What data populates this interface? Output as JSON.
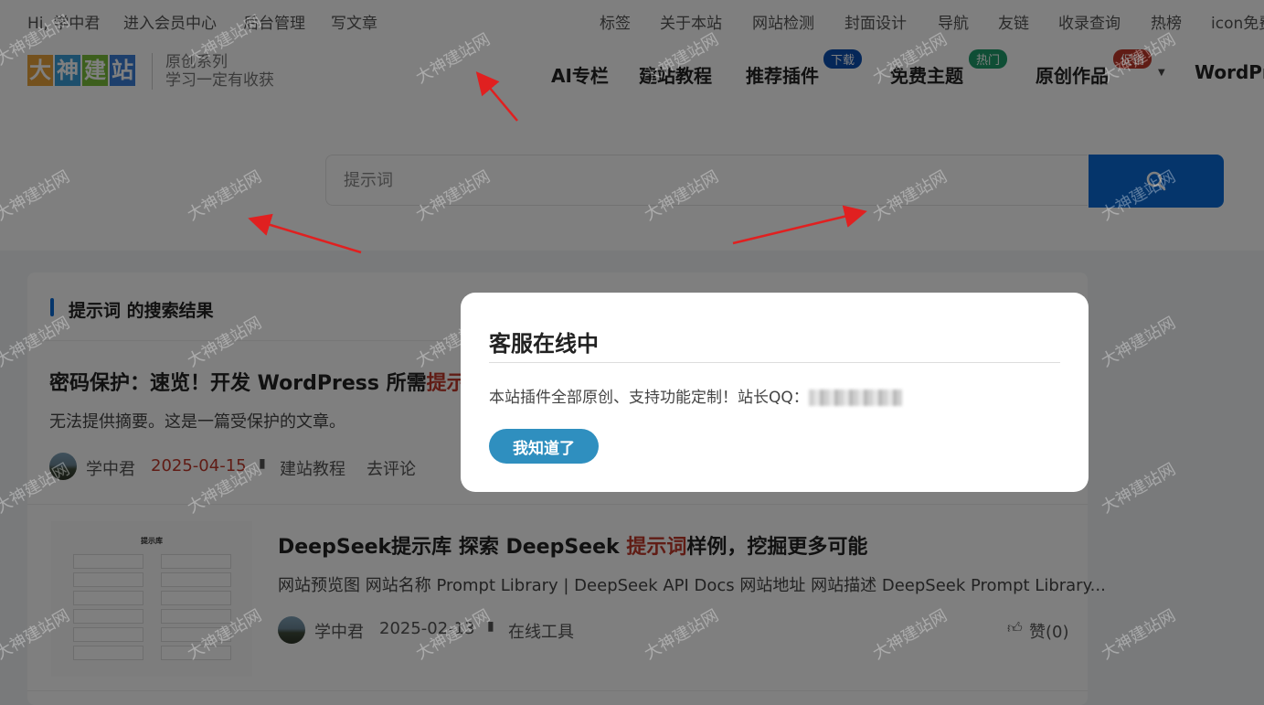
{
  "topbar": {
    "left": [
      "Hi, 学中君",
      "进入会员中心",
      "后台管理",
      "写文章"
    ],
    "right": [
      "标签",
      "关于本站",
      "网站检测",
      "封面设计",
      "导航",
      "友链",
      "收录查询",
      "热榜",
      "icon免费"
    ]
  },
  "logo": {
    "chars": [
      "大",
      "神",
      "建",
      "站"
    ],
    "slogan_line1": "原创系列",
    "slogan_line2": "学习一定有收获"
  },
  "nav": {
    "items": [
      "AI专栏",
      "建站教程",
      "推荐插件",
      "免费主题",
      "原创作品",
      "WordPr"
    ],
    "badges": {
      "plugins": "下载",
      "themes": "热门",
      "works": "促销"
    }
  },
  "search": {
    "placeholder": "提示词"
  },
  "results": {
    "heading": "提示词 的搜索结果",
    "posts": [
      {
        "title_prefix": "密码保护：速览！开发 WordPress 所需",
        "title_highlight": "提示",
        "excerpt": "无法提供摘要。这是一篇受保护的文章。",
        "author": "学中君",
        "date": "2025-04-15",
        "category": "建站教程",
        "comment": "去评论"
      },
      {
        "title_prefix": "DeepSeek提示库 探索 DeepSeek ",
        "title_highlight": "提示词",
        "title_suffix": "样例，挖掘更多可能",
        "excerpt": "网站预览图 网站名称 Prompt Library | DeepSeek API Docs 网站地址 网站描述 DeepSeek Prompt Library...",
        "author": "学中君",
        "date": "2025-02-13",
        "category": "在线工具",
        "likes": "赞(0)",
        "thumb_title": "提示库"
      }
    ]
  },
  "modal": {
    "title": "客服在线中",
    "text": "本站插件全部原创、支持功能定制！站长QQ：",
    "button": "我知道了"
  },
  "watermark": "大神建站网",
  "colors": {
    "accent_blue": "#0b6bd6",
    "highlight_red": "#c0392b",
    "modal_button": "#2f8fbf",
    "badge_download": "#0b4fb0",
    "badge_hot": "#1f9d6b",
    "badge_sale": "#c0392b",
    "arrow_red": "#e02020"
  }
}
